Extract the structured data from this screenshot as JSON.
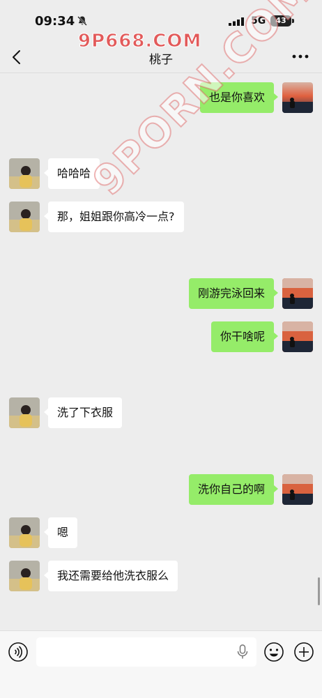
{
  "status_bar": {
    "time": "09:34",
    "network": "5G",
    "battery": "43"
  },
  "watermark": {
    "top": "9P668.COM",
    "diagonal": "9PORN.COM"
  },
  "nav": {
    "title": "桃子"
  },
  "messages": [
    {
      "side": "right",
      "text": "也是你喜欢"
    },
    {
      "side": "left",
      "text": "哈哈哈"
    },
    {
      "side": "left",
      "text": "那，姐姐跟你高冷一点?"
    },
    {
      "side": "right",
      "text": "刚游完泳回来"
    },
    {
      "side": "right",
      "text": "你干啥呢"
    },
    {
      "side": "left",
      "text": "洗了下衣服"
    },
    {
      "side": "right",
      "text": "洗你自己的啊"
    },
    {
      "side": "left",
      "text": "嗯"
    },
    {
      "side": "left",
      "text": "我还需要给他洗衣服么"
    }
  ],
  "colors": {
    "background": "#ededed",
    "sent_bubble": "#95ec69",
    "received_bubble": "#ffffff",
    "watermark": "#e25a5a"
  },
  "icons": {
    "back": "chevron-left-icon",
    "more": "more-dots-icon",
    "mute": "bell-slash-icon",
    "voice": "voice-icon",
    "mic": "microphone-icon",
    "emoji": "smiley-icon",
    "plus": "plus-circle-icon"
  }
}
